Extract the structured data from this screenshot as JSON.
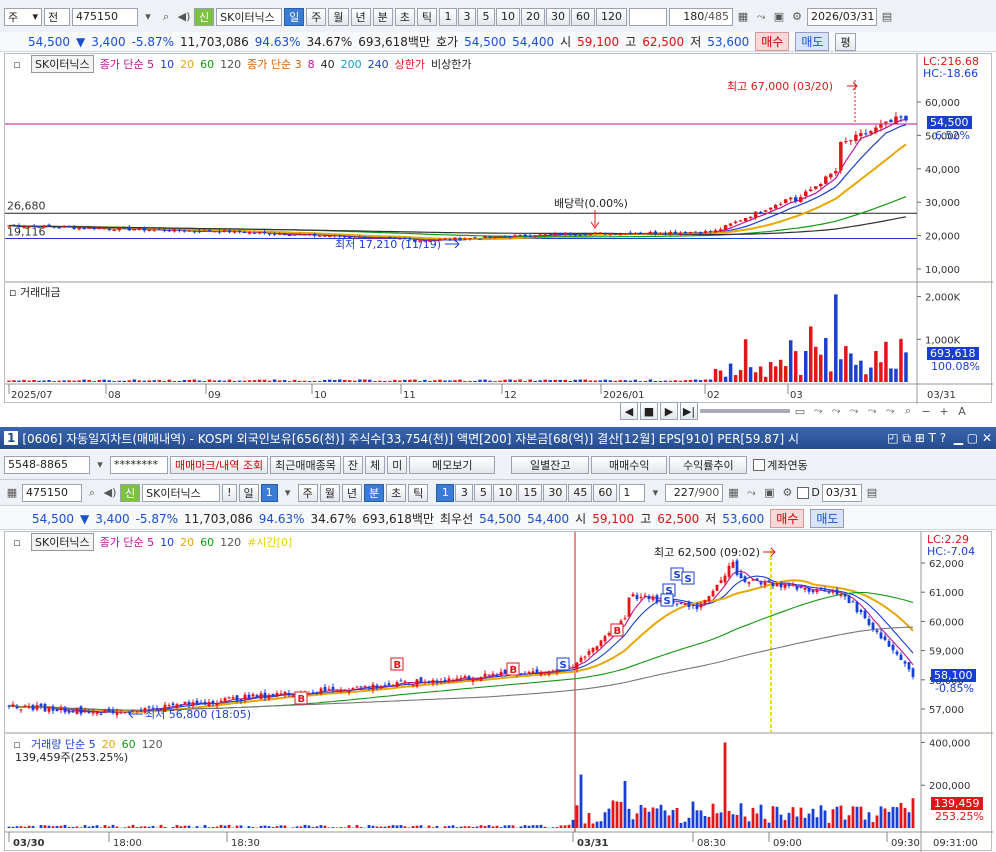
{
  "top": {
    "toolbar": {
      "market": "주",
      "type": "전",
      "code": "475150",
      "badge": "신",
      "name": "SK이터닉스",
      "periods": [
        "일",
        "주",
        "월",
        "년"
      ],
      "period_sel": "일",
      "units": [
        "분",
        "초",
        "틱"
      ],
      "intervals": [
        "1",
        "3",
        "5",
        "10",
        "20",
        "30",
        "60",
        "120"
      ],
      "count": "180",
      "count_total": "/485",
      "date": "2026/03/31"
    },
    "quote": {
      "price": "54,500",
      "change": "3,400",
      "pct": "-5.87%",
      "volume": "11,703,086",
      "ratio1": "94.63%",
      "ratio2": "34.67%",
      "amount": "693,618백만",
      "hoga_label": "호가",
      "ask": "54,500",
      "bid": "54,400",
      "open_label": "시",
      "open": "59,100",
      "high_label": "고",
      "high": "62,500",
      "low_label": "저",
      "low": "53,600",
      "buy": "매수",
      "sell": "매도",
      "eval": "평"
    },
    "legend": {
      "name": "SK이터닉스",
      "ma1": "종가 단순 5",
      "ma1_vals": [
        "10",
        "20",
        "60",
        "120"
      ],
      "ma2": "종가 단순 3",
      "ma2_vals": [
        "8",
        "40",
        "200",
        "240"
      ],
      "upper": "상한가",
      "lower": "비상한가"
    },
    "lc": "LC:216.68",
    "hc": "HC:-18.66",
    "yticks": [
      "60,000",
      "50,000",
      "40,000",
      "30,000",
      "20,000",
      "10,000"
    ],
    "price_tag": "54,500",
    "price_pct": "-6.52%",
    "high_note": "최고 67,000 (03/20)",
    "dividend_note": "배당락(0.00%)",
    "low_note": "최저 17,210 (11/19)",
    "level_a": "26,680",
    "level_b": "19,116",
    "vol_label": "거래대금",
    "vol_ticks": [
      "2,000K",
      "1,000K"
    ],
    "vol_tag": "693,618",
    "vol_pct": "100.08%",
    "xticks": [
      "2025/07",
      "08",
      "09",
      "10",
      "11",
      "12",
      "2026/01",
      "02",
      "03"
    ],
    "x_end": "03/31"
  },
  "bottom": {
    "title": "[0606] 자동일지차트(매매내역) - KOSPI 외국인보유[656(천)] 주식수[33,754(천)] 액면[200] 자본금[68(억)] 결산[12월] EPS[910] PER[59.87] 시",
    "win_num": "1",
    "row1": {
      "account": "5548-8865",
      "password": "********",
      "b1": "매매마크/내역 조회",
      "b2": "최근매매종목",
      "b3": "잔",
      "b4": "체",
      "b5": "미",
      "b6": "메모보기",
      "b7": "일별잔고",
      "b8": "매매수익",
      "b9": "수익률추이",
      "chk": "계좌연동"
    },
    "row2": {
      "code": "475150",
      "badge": "신",
      "name": "SK이터닉스",
      "excl": "!",
      "day": "일",
      "day_num": "1",
      "periods": [
        "주",
        "월",
        "년"
      ],
      "units": [
        "분",
        "초",
        "틱"
      ],
      "intervals": [
        "1",
        "3",
        "5",
        "10",
        "15",
        "30",
        "45",
        "60"
      ],
      "step": "1",
      "count": "227",
      "count_total": "/900",
      "d_label": "D",
      "date": "03/31"
    },
    "quote": {
      "price": "54,500",
      "change": "3,400",
      "pct": "-5.87%",
      "volume": "11,703,086",
      "ratio1": "94.63%",
      "ratio2": "34.67%",
      "amount": "693,618백만",
      "best_label": "최우선",
      "ask": "54,500",
      "bid": "54,400",
      "open_label": "시",
      "open": "59,100",
      "high_label": "고",
      "high": "62,500",
      "low_label": "저",
      "low": "53,600",
      "buy": "매수",
      "sell": "매도"
    },
    "legend": {
      "name": "SK이터닉스",
      "ma": "종가 단순 5",
      "ma_vals": [
        "10",
        "20",
        "60",
        "120"
      ],
      "extra": "#시간[0]"
    },
    "lc": "LC:2.29",
    "hc": "HC:-7.04",
    "yticks": [
      "62,000",
      "61,000",
      "60,000",
      "59,000",
      "58,000",
      "57,000"
    ],
    "price_tag": "58,100",
    "price_pct": "-0.85%",
    "high_note": "최고 62,500 (09:02)",
    "low_note": "최저 56,800 (18:05)",
    "vol_legend": "거래량 단순 5",
    "vol_legend_vals": [
      "20",
      "60",
      "120"
    ],
    "vol_info": "139,459주(253.25%)",
    "vol_ticks": [
      "400,000",
      "200,000"
    ],
    "vol_tag": "139,459",
    "vol_pct": "253.25%",
    "xticks": [
      "03/30",
      "18:00",
      "18:30",
      "03/31",
      "08:30",
      "09:00",
      "09:30"
    ],
    "x_end": "09:31:00"
  },
  "colors": {
    "up": "#e0161b",
    "down": "#1a3fd0",
    "ma5": "#c0129a",
    "ma10": "#1a3fd0",
    "ma20": "#e8a800",
    "ma60": "#119911",
    "ma120": "#333333"
  }
}
